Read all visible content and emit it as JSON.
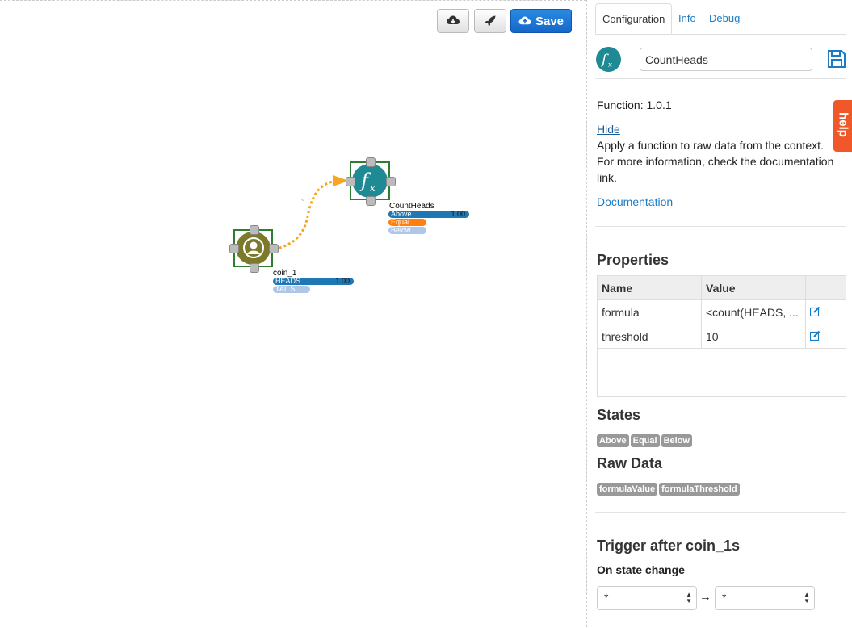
{
  "toolbar": {
    "download_icon": "cloud-download-icon",
    "deploy_icon": "rocket-icon",
    "save_label": "Save",
    "save_icon": "cloud-upload-icon"
  },
  "flow": {
    "nodes": [
      {
        "name": "coin_1",
        "icon": "person-icon",
        "color": "#7b7a2a",
        "states": [
          {
            "label": "HEADS",
            "value": "1.00",
            "color": "#1f77b4"
          },
          {
            "label": "TAILS",
            "value": "",
            "color": "#aec7e8"
          }
        ]
      },
      {
        "name": "CountHeads",
        "icon": "function-icon",
        "color": "#1f8a93",
        "states": [
          {
            "label": "Above",
            "value": "1.00",
            "color": "#1f77b4"
          },
          {
            "label": "Equal",
            "value": "",
            "color": "#ff7f0e"
          },
          {
            "label": "Below",
            "value": "",
            "color": "#aec7e8"
          }
        ]
      }
    ],
    "link_color": "#f5a623"
  },
  "panel": {
    "tabs": [
      "Configuration",
      "Info",
      "Debug"
    ],
    "active_tab": "Configuration",
    "node_name_value": "CountHeads",
    "function_version": "Function: 1.0.1",
    "hide_link": "Hide",
    "description": "Apply a function to raw data from the context. For more information, check the documentation link.",
    "documentation_link": "Documentation",
    "help_tab": "help",
    "properties": {
      "title": "Properties",
      "headers": [
        "Name",
        "Value"
      ],
      "rows": [
        {
          "name": "formula",
          "value": "<count(HEADS, ..."
        },
        {
          "name": "threshold",
          "value": "10"
        }
      ]
    },
    "states": {
      "title": "States",
      "items": [
        "Above",
        "Equal",
        "Below"
      ]
    },
    "raw_data": {
      "title": "Raw Data",
      "items": [
        "formulaValue",
        "formulaThreshold"
      ]
    },
    "trigger": {
      "title": "Trigger after coin_1s",
      "subtitle": "On state change",
      "from_value": "*",
      "to_value": "*",
      "arrow": "→"
    }
  }
}
